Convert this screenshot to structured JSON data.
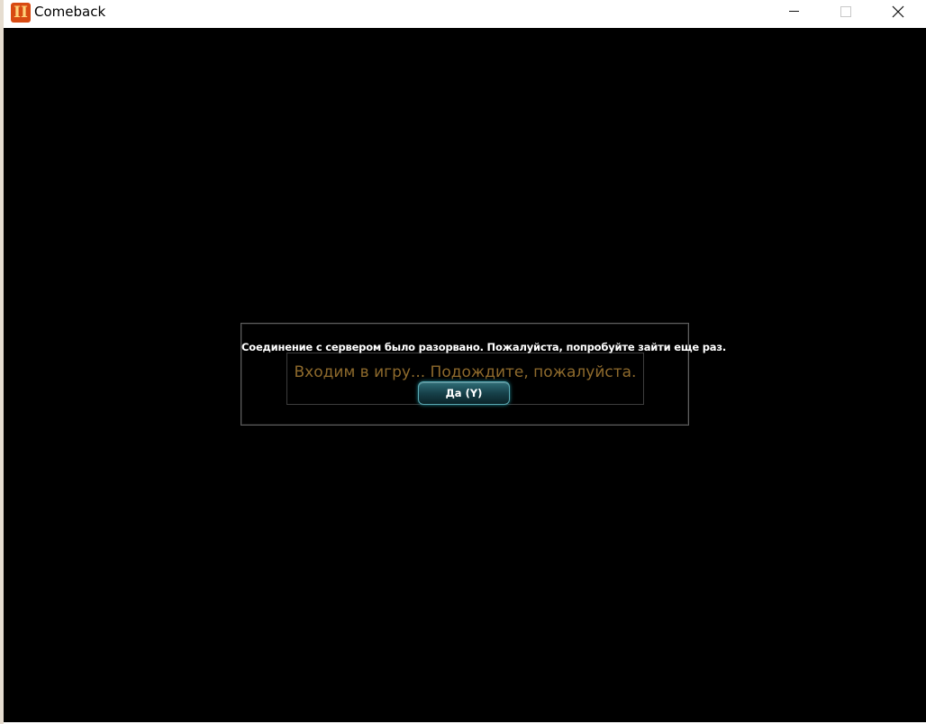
{
  "window": {
    "title": "Comeback",
    "icon": "game-logo-icon",
    "controls": {
      "minimize_icon": "minimize-icon",
      "maximize_icon": "maximize-icon",
      "close_icon": "close-icon",
      "close_glyph": "✕"
    }
  },
  "dialog": {
    "message": "Соединение с сервером было разорвано. Пожалуйста, попробуйте зайти еще раз.",
    "loading_text": "Входим в игру... Подождите, пожалуйста.",
    "ok_button_label": "Да (Y)"
  },
  "colors": {
    "background": "#000000",
    "loading_text": "#8e6a2c",
    "button_accent": "#2f6e78"
  }
}
